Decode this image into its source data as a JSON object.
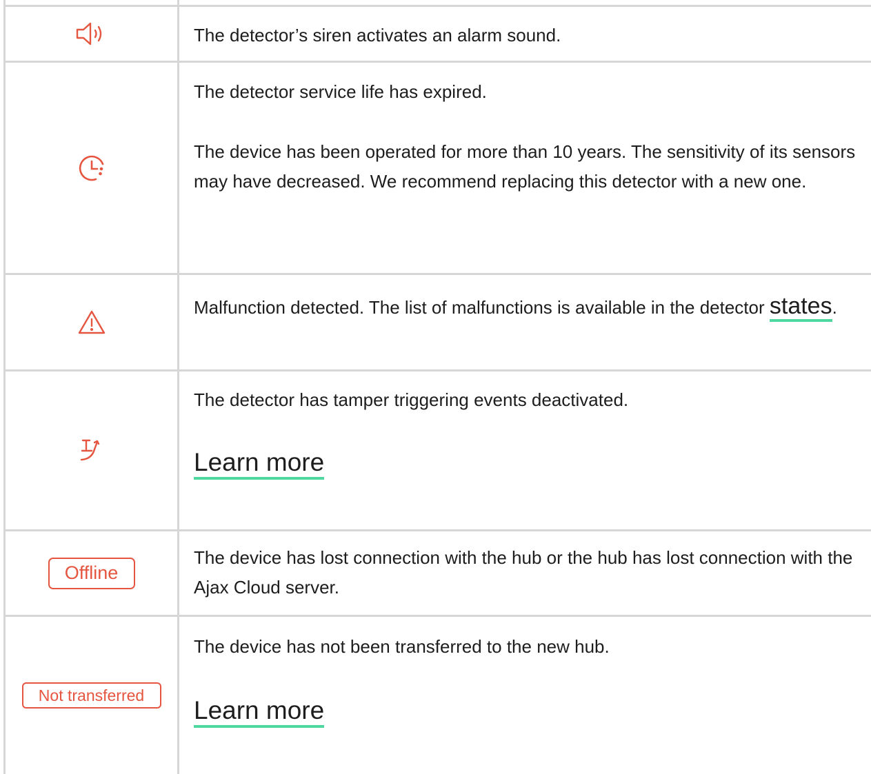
{
  "accent_color": "#e5553f",
  "link_underline_color": "#4ed8a0",
  "rows": [
    {
      "icon": "speaker-icon",
      "text": "The detector’s siren activates an alarm sound."
    },
    {
      "icon": "clock-icon",
      "text": "The detector service life has expired.",
      "text2": "The device has been operated for more than 10 years. The sensitivity of its sensors may have decreased. We recommend replacing this detector with a new one."
    },
    {
      "icon": "warning-icon",
      "text_before": "Malfunction detected. The list of malfunctions is available in the detector ",
      "link": "states",
      "text_after": "."
    },
    {
      "icon": "tamper-off-icon",
      "text": "The detector has tamper triggering events deactivated.",
      "link": "Learn more"
    },
    {
      "badge": "Offline",
      "text": "The device has lost connection with the hub or the hub has lost connection with the Ajax Cloud server."
    },
    {
      "badge": "Not transferred",
      "text": "The device has not been transferred to the new hub.",
      "link": "Learn more"
    }
  ]
}
